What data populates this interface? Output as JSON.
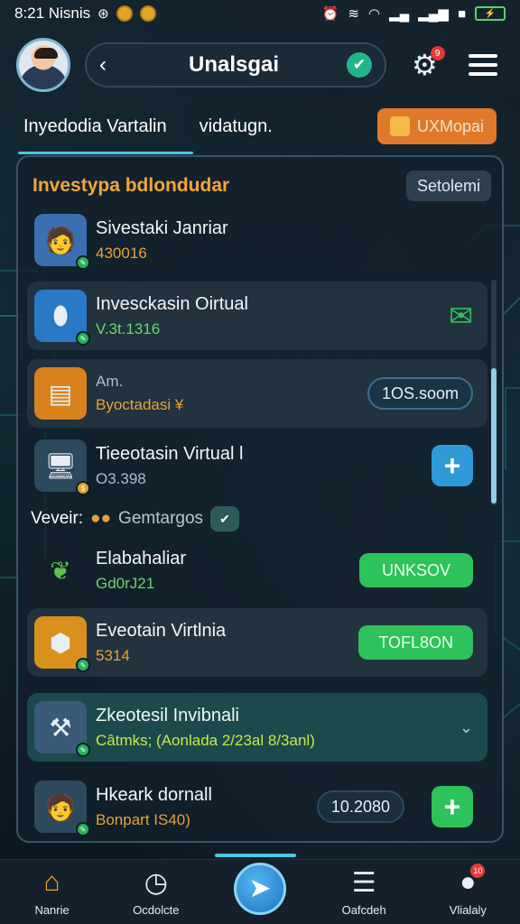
{
  "status_bar": {
    "time_carrier": "8:21 Nisnis",
    "battery_label": "⚡"
  },
  "header": {
    "back_icon": "‹",
    "title": "Unalsgai",
    "gear_badge": "9"
  },
  "tabs": {
    "tab1": "Inyedodia Vartalin",
    "tab2": "vidatugn.",
    "action_label": "UXMopai"
  },
  "panel": {
    "title": "Investypa bdlondudar",
    "button": "Setolemi"
  },
  "rows": [
    {
      "name": "Sivestaki Janriar",
      "sub": "430016"
    },
    {
      "name": "Invesckasin Oirtual",
      "sub": "V.3t.1316"
    },
    {
      "name": "Am.",
      "sub": "Byoctadasi ¥",
      "value": "1OS.soom"
    },
    {
      "name": "Tieeotasin Virtual",
      "suffix": "l",
      "sub": "O3.398"
    },
    {
      "name": "Elabahaliar",
      "sub": "Gd0rJ21",
      "button": "UNKSOV"
    },
    {
      "name": "Eveotain Virtlnia",
      "sub": "5314",
      "button": "TOFL8ON"
    },
    {
      "name": "Zkeotesil Invibnali",
      "sub": "Câtmks; (Aonlada 2/23al 8/3anl)"
    },
    {
      "name": "Hkeark dornall",
      "sub": "Bonpart IS40)",
      "value": "10.2080"
    }
  ],
  "section": {
    "label": "Veveir:",
    "muted": "Gemtargos"
  },
  "bottom_nav": [
    {
      "label": "Nanrie"
    },
    {
      "label": "Ocdolcte"
    },
    {
      "label": ""
    },
    {
      "label": "Oafcdeh"
    },
    {
      "label": "Vlialaly",
      "badge": "10"
    }
  ]
}
